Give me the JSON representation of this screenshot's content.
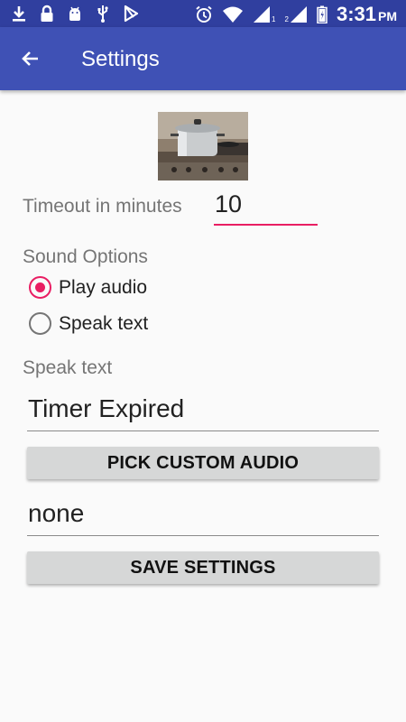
{
  "status_bar": {
    "time": "3:31",
    "ampm": "PM",
    "sim1": "1",
    "sim2": "2"
  },
  "app_bar": {
    "title": "Settings"
  },
  "timeout": {
    "label": "Timeout in minutes",
    "value": "10"
  },
  "sound_options": {
    "label": "Sound Options",
    "options": [
      {
        "label": "Play audio",
        "checked": true
      },
      {
        "label": "Speak text",
        "checked": false
      }
    ]
  },
  "speak_text": {
    "label": "Speak text",
    "value": "Timer Expired"
  },
  "buttons": {
    "pick_custom_audio": "PICK CUSTOM AUDIO",
    "save_settings": "SAVE SETTINGS"
  },
  "custom_audio": {
    "value": "none"
  },
  "colors": {
    "primary": "#3f51b5",
    "primary_dark": "#303f9f",
    "accent": "#e91e63"
  }
}
